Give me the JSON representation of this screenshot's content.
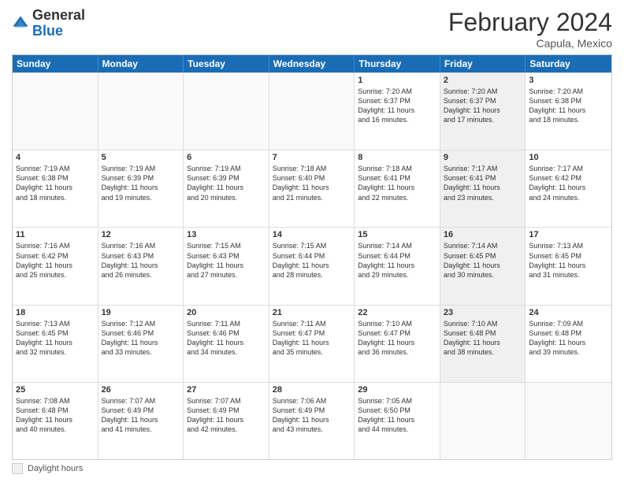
{
  "header": {
    "logo_general": "General",
    "logo_blue": "Blue",
    "month_title": "February 2024",
    "subtitle": "Capula, Mexico"
  },
  "days_of_week": [
    "Sunday",
    "Monday",
    "Tuesday",
    "Wednesday",
    "Thursday",
    "Friday",
    "Saturday"
  ],
  "footer": {
    "daylight_label": "Daylight hours"
  },
  "weeks": [
    [
      {
        "day": "",
        "empty": true
      },
      {
        "day": "",
        "empty": true
      },
      {
        "day": "",
        "empty": true
      },
      {
        "day": "",
        "empty": true
      },
      {
        "day": "1",
        "info": "Sunrise: 7:20 AM\nSunset: 6:37 PM\nDaylight: 11 hours\nand 16 minutes.",
        "shaded": false
      },
      {
        "day": "2",
        "info": "Sunrise: 7:20 AM\nSunset: 6:37 PM\nDaylight: 11 hours\nand 17 minutes.",
        "shaded": true
      },
      {
        "day": "3",
        "info": "Sunrise: 7:20 AM\nSunset: 6:38 PM\nDaylight: 11 hours\nand 18 minutes.",
        "shaded": false
      }
    ],
    [
      {
        "day": "4",
        "info": "Sunrise: 7:19 AM\nSunset: 6:38 PM\nDaylight: 11 hours\nand 18 minutes.",
        "shaded": false
      },
      {
        "day": "5",
        "info": "Sunrise: 7:19 AM\nSunset: 6:39 PM\nDaylight: 11 hours\nand 19 minutes.",
        "shaded": false
      },
      {
        "day": "6",
        "info": "Sunrise: 7:19 AM\nSunset: 6:39 PM\nDaylight: 11 hours\nand 20 minutes.",
        "shaded": false
      },
      {
        "day": "7",
        "info": "Sunrise: 7:18 AM\nSunset: 6:40 PM\nDaylight: 11 hours\nand 21 minutes.",
        "shaded": false
      },
      {
        "day": "8",
        "info": "Sunrise: 7:18 AM\nSunset: 6:41 PM\nDaylight: 11 hours\nand 22 minutes.",
        "shaded": false
      },
      {
        "day": "9",
        "info": "Sunrise: 7:17 AM\nSunset: 6:41 PM\nDaylight: 11 hours\nand 23 minutes.",
        "shaded": true
      },
      {
        "day": "10",
        "info": "Sunrise: 7:17 AM\nSunset: 6:42 PM\nDaylight: 11 hours\nand 24 minutes.",
        "shaded": false
      }
    ],
    [
      {
        "day": "11",
        "info": "Sunrise: 7:16 AM\nSunset: 6:42 PM\nDaylight: 11 hours\nand 25 minutes.",
        "shaded": false
      },
      {
        "day": "12",
        "info": "Sunrise: 7:16 AM\nSunset: 6:43 PM\nDaylight: 11 hours\nand 26 minutes.",
        "shaded": false
      },
      {
        "day": "13",
        "info": "Sunrise: 7:15 AM\nSunset: 6:43 PM\nDaylight: 11 hours\nand 27 minutes.",
        "shaded": false
      },
      {
        "day": "14",
        "info": "Sunrise: 7:15 AM\nSunset: 6:44 PM\nDaylight: 11 hours\nand 28 minutes.",
        "shaded": false
      },
      {
        "day": "15",
        "info": "Sunrise: 7:14 AM\nSunset: 6:44 PM\nDaylight: 11 hours\nand 29 minutes.",
        "shaded": false
      },
      {
        "day": "16",
        "info": "Sunrise: 7:14 AM\nSunset: 6:45 PM\nDaylight: 11 hours\nand 30 minutes.",
        "shaded": true
      },
      {
        "day": "17",
        "info": "Sunrise: 7:13 AM\nSunset: 6:45 PM\nDaylight: 11 hours\nand 31 minutes.",
        "shaded": false
      }
    ],
    [
      {
        "day": "18",
        "info": "Sunrise: 7:13 AM\nSunset: 6:45 PM\nDaylight: 11 hours\nand 32 minutes.",
        "shaded": false
      },
      {
        "day": "19",
        "info": "Sunrise: 7:12 AM\nSunset: 6:46 PM\nDaylight: 11 hours\nand 33 minutes.",
        "shaded": false
      },
      {
        "day": "20",
        "info": "Sunrise: 7:11 AM\nSunset: 6:46 PM\nDaylight: 11 hours\nand 34 minutes.",
        "shaded": false
      },
      {
        "day": "21",
        "info": "Sunrise: 7:11 AM\nSunset: 6:47 PM\nDaylight: 11 hours\nand 35 minutes.",
        "shaded": false
      },
      {
        "day": "22",
        "info": "Sunrise: 7:10 AM\nSunset: 6:47 PM\nDaylight: 11 hours\nand 36 minutes.",
        "shaded": false
      },
      {
        "day": "23",
        "info": "Sunrise: 7:10 AM\nSunset: 6:48 PM\nDaylight: 11 hours\nand 38 minutes.",
        "shaded": true
      },
      {
        "day": "24",
        "info": "Sunrise: 7:09 AM\nSunset: 6:48 PM\nDaylight: 11 hours\nand 39 minutes.",
        "shaded": false
      }
    ],
    [
      {
        "day": "25",
        "info": "Sunrise: 7:08 AM\nSunset: 6:48 PM\nDaylight: 11 hours\nand 40 minutes.",
        "shaded": false
      },
      {
        "day": "26",
        "info": "Sunrise: 7:07 AM\nSunset: 6:49 PM\nDaylight: 11 hours\nand 41 minutes.",
        "shaded": false
      },
      {
        "day": "27",
        "info": "Sunrise: 7:07 AM\nSunset: 6:49 PM\nDaylight: 11 hours\nand 42 minutes.",
        "shaded": false
      },
      {
        "day": "28",
        "info": "Sunrise: 7:06 AM\nSunset: 6:49 PM\nDaylight: 11 hours\nand 43 minutes.",
        "shaded": false
      },
      {
        "day": "29",
        "info": "Sunrise: 7:05 AM\nSunset: 6:50 PM\nDaylight: 11 hours\nand 44 minutes.",
        "shaded": false
      },
      {
        "day": "",
        "empty": true
      },
      {
        "day": "",
        "empty": true
      }
    ]
  ]
}
